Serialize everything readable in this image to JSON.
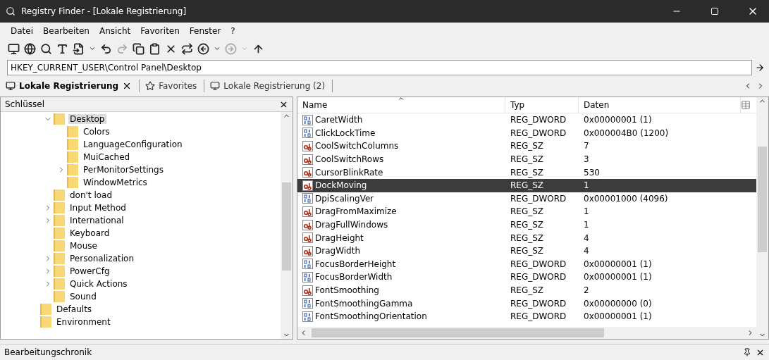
{
  "window": {
    "title": "Registry Finder - [Lokale Registrierung]"
  },
  "menu": [
    "Datei",
    "Bearbeiten",
    "Ansicht",
    "Favoriten",
    "Fenster",
    "?"
  ],
  "address": {
    "value": "HKEY_CURRENT_USER\\Control Panel\\Desktop"
  },
  "tabs": [
    {
      "label": "Lokale Registrierung",
      "selected": true,
      "kind": "registry"
    },
    {
      "label": "Favorites",
      "selected": false,
      "kind": "favorites"
    },
    {
      "label": "Lokale Registrierung (2)",
      "selected": false,
      "kind": "registry"
    }
  ],
  "tree": {
    "title": "Schlüssel",
    "items": [
      {
        "children": [
          {
            "label": "Desktop",
            "selected": true,
            "expanded": true,
            "children": [
              {
                "label": "Colors",
                "selected": false
              },
              {
                "label": "LanguageConfiguration",
                "selected": false
              },
              {
                "label": "MuiCached",
                "selected": false
              },
              {
                "label": "PerMonitorSettings",
                "selected": false,
                "expanded": false
              },
              {
                "label": "WindowMetrics",
                "selected": false
              }
            ]
          },
          {
            "label": "don't load",
            "selected": false
          },
          {
            "label": "Input Method",
            "selected": false,
            "expanded": false
          },
          {
            "label": "International",
            "selected": false,
            "expanded": false
          },
          {
            "label": "Keyboard",
            "selected": false
          },
          {
            "label": "Mouse",
            "selected": false
          },
          {
            "label": "Personalization",
            "selected": false,
            "expanded": false
          },
          {
            "label": "PowerCfg",
            "selected": false,
            "expanded": false
          },
          {
            "label": "Quick Actions",
            "selected": false,
            "expanded": false
          },
          {
            "label": "Sound",
            "selected": false
          }
        ]
      },
      {
        "label": "Defaults",
        "selected": false
      },
      {
        "label": "Environment",
        "selected": false
      }
    ]
  },
  "table": {
    "columns": [
      "Name",
      "Typ",
      "Daten"
    ],
    "rows": [
      {
        "kind": "dword",
        "name": "CaretWidth",
        "type": "REG_DWORD",
        "data": "0x00000001 (1)",
        "selected": false
      },
      {
        "kind": "dword",
        "name": "ClickLockTime",
        "type": "REG_DWORD",
        "data": "0x000004B0 (1200)",
        "selected": false
      },
      {
        "kind": "sz",
        "name": "CoolSwitchColumns",
        "type": "REG_SZ",
        "data": "7",
        "selected": false
      },
      {
        "kind": "sz",
        "name": "CoolSwitchRows",
        "type": "REG_SZ",
        "data": "3",
        "selected": false
      },
      {
        "kind": "sz",
        "name": "CursorBlinkRate",
        "type": "REG_SZ",
        "data": "530",
        "selected": false
      },
      {
        "kind": "sz",
        "name": "DockMoving",
        "type": "REG_SZ",
        "data": "1",
        "selected": true
      },
      {
        "kind": "dword",
        "name": "DpiScalingVer",
        "type": "REG_DWORD",
        "data": "0x00001000 (4096)",
        "selected": false
      },
      {
        "kind": "sz",
        "name": "DragFromMaximize",
        "type": "REG_SZ",
        "data": "1",
        "selected": false
      },
      {
        "kind": "sz",
        "name": "DragFullWindows",
        "type": "REG_SZ",
        "data": "1",
        "selected": false
      },
      {
        "kind": "sz",
        "name": "DragHeight",
        "type": "REG_SZ",
        "data": "4",
        "selected": false
      },
      {
        "kind": "sz",
        "name": "DragWidth",
        "type": "REG_SZ",
        "data": "4",
        "selected": false
      },
      {
        "kind": "dword",
        "name": "FocusBorderHeight",
        "type": "REG_DWORD",
        "data": "0x00000001 (1)",
        "selected": false
      },
      {
        "kind": "dword",
        "name": "FocusBorderWidth",
        "type": "REG_DWORD",
        "data": "0x00000001 (1)",
        "selected": false
      },
      {
        "kind": "sz",
        "name": "FontSmoothing",
        "type": "REG_SZ",
        "data": "2",
        "selected": false
      },
      {
        "kind": "dword",
        "name": "FontSmoothingGamma",
        "type": "REG_DWORD",
        "data": "0x00000000 (0)",
        "selected": false
      },
      {
        "kind": "dword",
        "name": "FontSmoothingOrientation",
        "type": "REG_DWORD",
        "data": "0x00000001 (1)",
        "selected": false
      }
    ]
  },
  "bottom_panel": {
    "title": "Bearbeitungschronik"
  }
}
